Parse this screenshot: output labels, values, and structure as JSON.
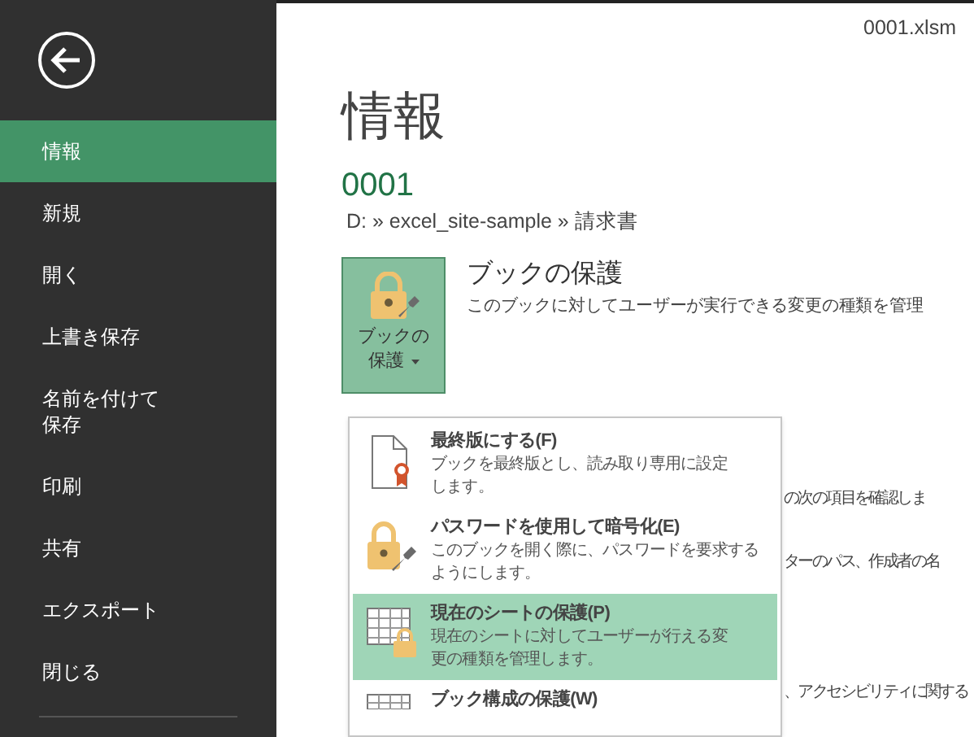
{
  "file_name": "0001.xlsm",
  "sidebar": {
    "items": [
      {
        "label": "情報",
        "selected": true
      },
      {
        "label": "新規",
        "selected": false
      },
      {
        "label": "開く",
        "selected": false
      },
      {
        "label": "上書き保存",
        "selected": false
      },
      {
        "label": "名前を付けて保存",
        "selected": false
      },
      {
        "label": "印刷",
        "selected": false
      },
      {
        "label": "共有",
        "selected": false
      },
      {
        "label": "エクスポート",
        "selected": false
      },
      {
        "label": "閉じる",
        "selected": false
      }
    ]
  },
  "page_title": "情報",
  "document": {
    "name": "0001",
    "path": "D: » excel_site-sample » 請求書"
  },
  "protect": {
    "button_lines": [
      "ブックの",
      "保護"
    ],
    "title": "ブックの保護",
    "description": "このブックに対してユーザーが実行できる変更の種類を管理"
  },
  "background_lines": [
    "の次の項目を確認しま",
    "ターのパス、作成者の名",
    "、アクセシビリティに関する"
  ],
  "menu": {
    "items": [
      {
        "kind": "final",
        "title": "最終版にする(F)",
        "description_lines": [
          "ブックを最終版とし、読み取り専用に設定",
          "します。"
        ],
        "selected": false
      },
      {
        "kind": "password",
        "title": "パスワードを使用して暗号化(E)",
        "description_lines": [
          "このブックを開く際に、パスワードを要求する",
          "ようにします。"
        ],
        "selected": false
      },
      {
        "kind": "sheet",
        "title": "現在のシートの保護(P)",
        "description_lines": [
          "現在のシートに対してユーザーが行える変",
          "更の種類を管理します。"
        ],
        "selected": true
      },
      {
        "kind": "structure",
        "title": "ブック構成の保護(W)",
        "selected": false
      }
    ]
  }
}
